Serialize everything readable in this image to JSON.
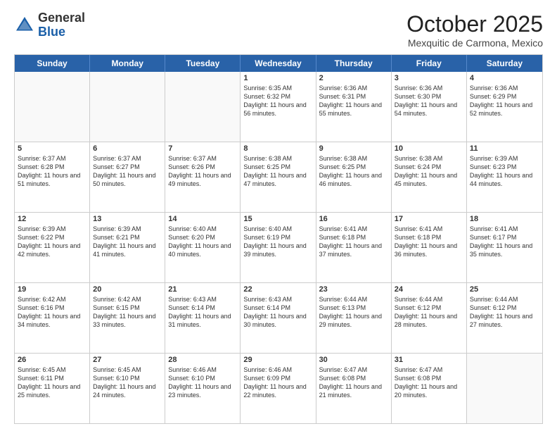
{
  "header": {
    "logo_general": "General",
    "logo_blue": "Blue",
    "month_title": "October 2025",
    "subtitle": "Mexquitic de Carmona, Mexico"
  },
  "days_of_week": [
    "Sunday",
    "Monday",
    "Tuesday",
    "Wednesday",
    "Thursday",
    "Friday",
    "Saturday"
  ],
  "weeks": [
    [
      {
        "day": "",
        "info": ""
      },
      {
        "day": "",
        "info": ""
      },
      {
        "day": "",
        "info": ""
      },
      {
        "day": "1",
        "info": "Sunrise: 6:35 AM\nSunset: 6:32 PM\nDaylight: 11 hours and 56 minutes."
      },
      {
        "day": "2",
        "info": "Sunrise: 6:36 AM\nSunset: 6:31 PM\nDaylight: 11 hours and 55 minutes."
      },
      {
        "day": "3",
        "info": "Sunrise: 6:36 AM\nSunset: 6:30 PM\nDaylight: 11 hours and 54 minutes."
      },
      {
        "day": "4",
        "info": "Sunrise: 6:36 AM\nSunset: 6:29 PM\nDaylight: 11 hours and 52 minutes."
      }
    ],
    [
      {
        "day": "5",
        "info": "Sunrise: 6:37 AM\nSunset: 6:28 PM\nDaylight: 11 hours and 51 minutes."
      },
      {
        "day": "6",
        "info": "Sunrise: 6:37 AM\nSunset: 6:27 PM\nDaylight: 11 hours and 50 minutes."
      },
      {
        "day": "7",
        "info": "Sunrise: 6:37 AM\nSunset: 6:26 PM\nDaylight: 11 hours and 49 minutes."
      },
      {
        "day": "8",
        "info": "Sunrise: 6:38 AM\nSunset: 6:25 PM\nDaylight: 11 hours and 47 minutes."
      },
      {
        "day": "9",
        "info": "Sunrise: 6:38 AM\nSunset: 6:25 PM\nDaylight: 11 hours and 46 minutes."
      },
      {
        "day": "10",
        "info": "Sunrise: 6:38 AM\nSunset: 6:24 PM\nDaylight: 11 hours and 45 minutes."
      },
      {
        "day": "11",
        "info": "Sunrise: 6:39 AM\nSunset: 6:23 PM\nDaylight: 11 hours and 44 minutes."
      }
    ],
    [
      {
        "day": "12",
        "info": "Sunrise: 6:39 AM\nSunset: 6:22 PM\nDaylight: 11 hours and 42 minutes."
      },
      {
        "day": "13",
        "info": "Sunrise: 6:39 AM\nSunset: 6:21 PM\nDaylight: 11 hours and 41 minutes."
      },
      {
        "day": "14",
        "info": "Sunrise: 6:40 AM\nSunset: 6:20 PM\nDaylight: 11 hours and 40 minutes."
      },
      {
        "day": "15",
        "info": "Sunrise: 6:40 AM\nSunset: 6:19 PM\nDaylight: 11 hours and 39 minutes."
      },
      {
        "day": "16",
        "info": "Sunrise: 6:41 AM\nSunset: 6:18 PM\nDaylight: 11 hours and 37 minutes."
      },
      {
        "day": "17",
        "info": "Sunrise: 6:41 AM\nSunset: 6:18 PM\nDaylight: 11 hours and 36 minutes."
      },
      {
        "day": "18",
        "info": "Sunrise: 6:41 AM\nSunset: 6:17 PM\nDaylight: 11 hours and 35 minutes."
      }
    ],
    [
      {
        "day": "19",
        "info": "Sunrise: 6:42 AM\nSunset: 6:16 PM\nDaylight: 11 hours and 34 minutes."
      },
      {
        "day": "20",
        "info": "Sunrise: 6:42 AM\nSunset: 6:15 PM\nDaylight: 11 hours and 33 minutes."
      },
      {
        "day": "21",
        "info": "Sunrise: 6:43 AM\nSunset: 6:14 PM\nDaylight: 11 hours and 31 minutes."
      },
      {
        "day": "22",
        "info": "Sunrise: 6:43 AM\nSunset: 6:14 PM\nDaylight: 11 hours and 30 minutes."
      },
      {
        "day": "23",
        "info": "Sunrise: 6:44 AM\nSunset: 6:13 PM\nDaylight: 11 hours and 29 minutes."
      },
      {
        "day": "24",
        "info": "Sunrise: 6:44 AM\nSunset: 6:12 PM\nDaylight: 11 hours and 28 minutes."
      },
      {
        "day": "25",
        "info": "Sunrise: 6:44 AM\nSunset: 6:12 PM\nDaylight: 11 hours and 27 minutes."
      }
    ],
    [
      {
        "day": "26",
        "info": "Sunrise: 6:45 AM\nSunset: 6:11 PM\nDaylight: 11 hours and 25 minutes."
      },
      {
        "day": "27",
        "info": "Sunrise: 6:45 AM\nSunset: 6:10 PM\nDaylight: 11 hours and 24 minutes."
      },
      {
        "day": "28",
        "info": "Sunrise: 6:46 AM\nSunset: 6:10 PM\nDaylight: 11 hours and 23 minutes."
      },
      {
        "day": "29",
        "info": "Sunrise: 6:46 AM\nSunset: 6:09 PM\nDaylight: 11 hours and 22 minutes."
      },
      {
        "day": "30",
        "info": "Sunrise: 6:47 AM\nSunset: 6:08 PM\nDaylight: 11 hours and 21 minutes."
      },
      {
        "day": "31",
        "info": "Sunrise: 6:47 AM\nSunset: 6:08 PM\nDaylight: 11 hours and 20 minutes."
      },
      {
        "day": "",
        "info": ""
      }
    ]
  ]
}
